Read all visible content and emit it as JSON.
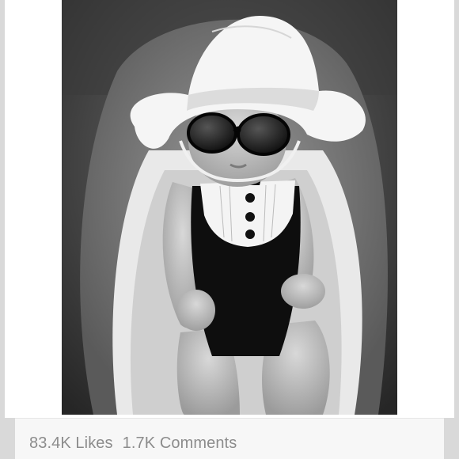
{
  "post": {
    "photo_icon": "photo-image",
    "likes_label": "83.4K Likes",
    "comments_label": "1.7K Comments"
  },
  "colors": {
    "background": "#d9d9d9",
    "card": "#ffffff",
    "stats_text": "#8c8c8c"
  }
}
